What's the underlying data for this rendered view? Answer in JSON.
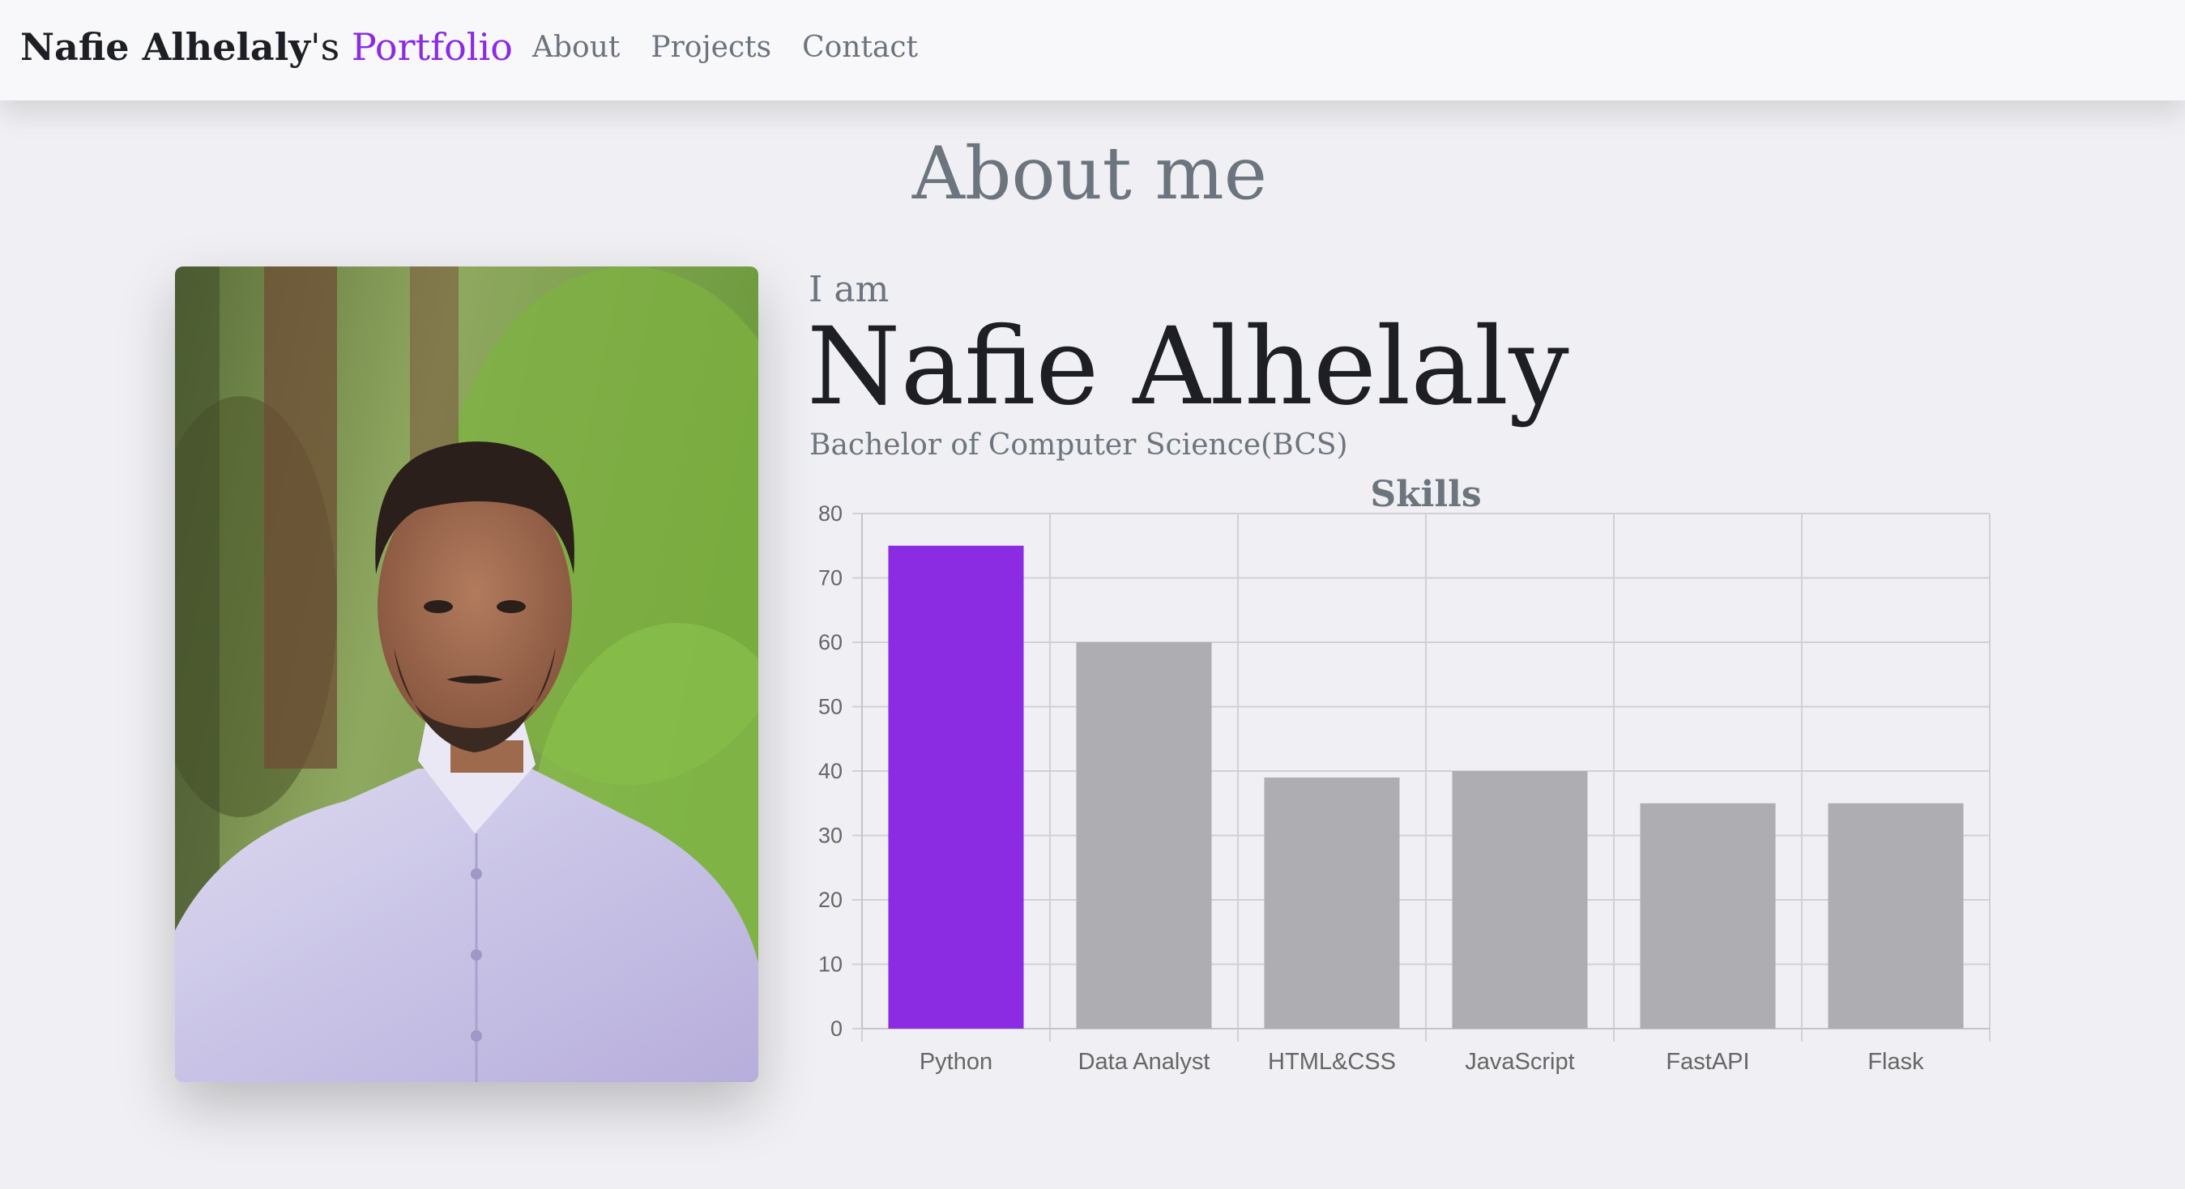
{
  "nav": {
    "brand_name": "Nafie Alhelaly",
    "brand_suffix": "'s",
    "brand_accent": "Portfolio",
    "links": [
      "About",
      "Projects",
      "Contact"
    ]
  },
  "about": {
    "heading": "About me",
    "intro": "I am",
    "name": "Nafie Alhelaly",
    "degree": "Bachelor of Computer Science(BCS)"
  },
  "colors": {
    "accent": "#8b2be2",
    "bar_default": "#adadb2",
    "background": "#f0f0f4"
  },
  "chart_data": {
    "type": "bar",
    "title": "Skills",
    "categories": [
      "Python",
      "Data Analyst",
      "HTML&CSS",
      "JavaScript",
      "FastAPI",
      "Flask"
    ],
    "values": [
      75,
      60,
      39,
      40,
      35,
      35
    ],
    "ylim": [
      0,
      80
    ],
    "y_ticks": [
      0,
      10,
      20,
      30,
      40,
      50,
      60,
      70,
      80
    ],
    "grid": true,
    "legend": "none",
    "highlight_index": 0
  }
}
